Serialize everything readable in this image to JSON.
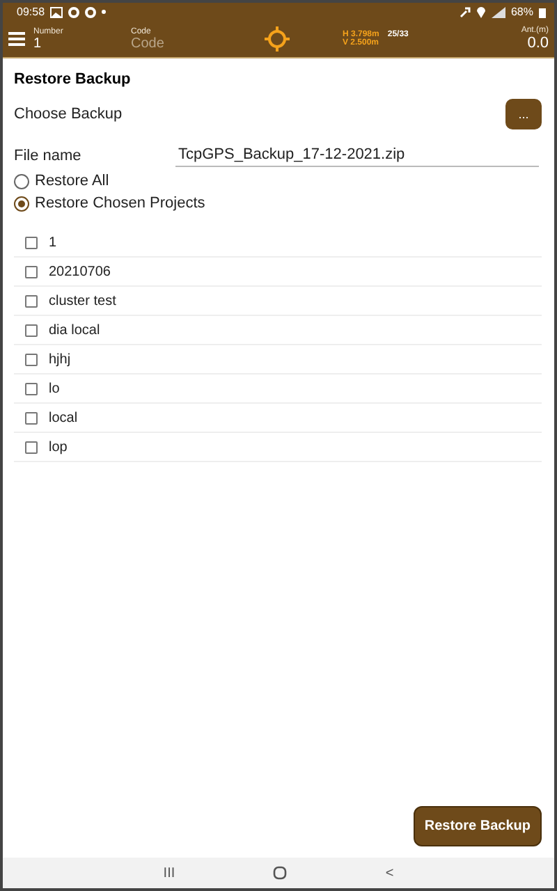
{
  "status_bar": {
    "time": "09:58",
    "battery": "68%"
  },
  "header": {
    "number_label": "Number",
    "number_value": "1",
    "code_label": "Code",
    "code_placeholder": "Code",
    "h_precision": "H 3.798m",
    "satellites": "25/33",
    "v_precision": "V 2.500m",
    "antenna_label": "Ant.(m)",
    "antenna_value": "0.0"
  },
  "title": "Restore Backup",
  "choose_backup": {
    "label": "Choose Backup",
    "button": "..."
  },
  "file_name": {
    "label": "File name",
    "value": "TcpGPS_Backup_17-12-2021.zip"
  },
  "restore_options": [
    {
      "label": "Restore All",
      "selected": false
    },
    {
      "label": "Restore Chosen Projects",
      "selected": true
    }
  ],
  "projects": [
    {
      "name": "1",
      "checked": false
    },
    {
      "name": "20210706",
      "checked": false
    },
    {
      "name": "cluster test",
      "checked": false
    },
    {
      "name": "dia local",
      "checked": false
    },
    {
      "name": "hjhj",
      "checked": false
    },
    {
      "name": "lo",
      "checked": false
    },
    {
      "name": "local",
      "checked": false
    },
    {
      "name": "lop",
      "checked": false
    }
  ],
  "restore_button": "Restore Backup",
  "nav_bar": {
    "recents": "III",
    "back": "<"
  }
}
